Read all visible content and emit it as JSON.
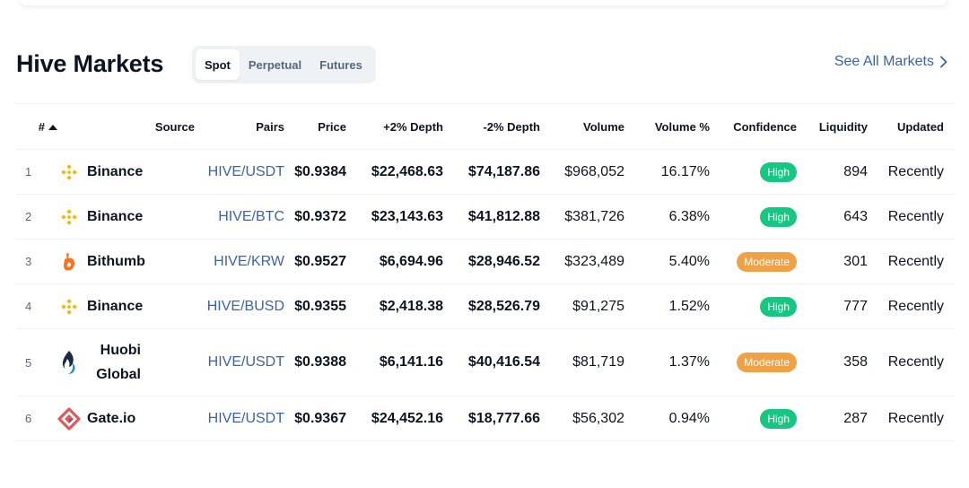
{
  "header": {
    "title": "Hive Markets",
    "see_all": "See All Markets"
  },
  "tabs": [
    {
      "label": "Spot",
      "active": true
    },
    {
      "label": "Perpetual",
      "active": false
    },
    {
      "label": "Futures",
      "active": false
    }
  ],
  "columns": {
    "rank": "#",
    "source": "Source",
    "pairs": "Pairs",
    "price": "Price",
    "depth_plus": "+2% Depth",
    "depth_minus": "-2% Depth",
    "volume": "Volume",
    "volume_pct": "Volume %",
    "confidence": "Confidence",
    "liquidity": "Liquidity",
    "updated": "Updated"
  },
  "rows": [
    {
      "rank": "1",
      "source": "Binance",
      "logo": "binance-icon",
      "pair": "HIVE/USDT",
      "price": "$0.9384",
      "depth_plus": "$22,468.63",
      "depth_minus": "$74,187.86",
      "volume": "$968,052",
      "volume_pct": "16.17%",
      "confidence": "High",
      "liquidity": "894",
      "updated": "Recently"
    },
    {
      "rank": "2",
      "source": "Binance",
      "logo": "binance-icon",
      "pair": "HIVE/BTC",
      "price": "$0.9372",
      "depth_plus": "$23,143.63",
      "depth_minus": "$41,812.88",
      "volume": "$381,726",
      "volume_pct": "6.38%",
      "confidence": "High",
      "liquidity": "643",
      "updated": "Recently"
    },
    {
      "rank": "3",
      "source": "Bithumb",
      "logo": "bithumb-icon",
      "pair": "HIVE/KRW",
      "price": "$0.9527",
      "depth_plus": "$6,694.96",
      "depth_minus": "$28,946.52",
      "volume": "$323,489",
      "volume_pct": "5.40%",
      "confidence": "Moderate",
      "liquidity": "301",
      "updated": "Recently"
    },
    {
      "rank": "4",
      "source": "Binance",
      "logo": "binance-icon",
      "pair": "HIVE/BUSD",
      "price": "$0.9355",
      "depth_plus": "$2,418.38",
      "depth_minus": "$28,526.79",
      "volume": "$91,275",
      "volume_pct": "1.52%",
      "confidence": "High",
      "liquidity": "777",
      "updated": "Recently"
    },
    {
      "rank": "5",
      "source": "Huobi Global",
      "logo": "huobi-icon",
      "pair": "HIVE/USDT",
      "price": "$0.9388",
      "depth_plus": "$6,141.16",
      "depth_minus": "$40,416.54",
      "volume": "$81,719",
      "volume_pct": "1.37%",
      "confidence": "Moderate",
      "liquidity": "358",
      "updated": "Recently"
    },
    {
      "rank": "6",
      "source": "Gate.io",
      "logo": "gateio-icon",
      "pair": "HIVE/USDT",
      "price": "$0.9367",
      "depth_plus": "$24,452.16",
      "depth_minus": "$18,777.66",
      "volume": "$56,302",
      "volume_pct": "0.94%",
      "confidence": "High",
      "liquidity": "287",
      "updated": "Recently"
    }
  ],
  "colors": {
    "link": "#3b63a8",
    "high": "#16c784",
    "moderate": "#f0a145",
    "binance": "#f0b90b",
    "bithumb": "#f37321",
    "huobi": "#1c2a4a",
    "gateio": "#de5959"
  }
}
